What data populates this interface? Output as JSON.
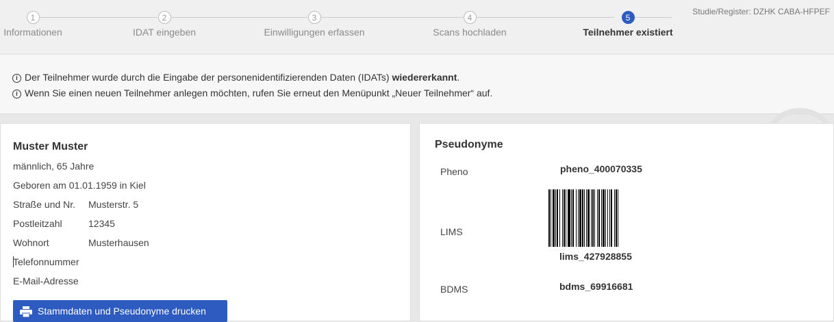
{
  "stepper": {
    "steps": [
      {
        "number": "1",
        "label": "Informationen"
      },
      {
        "number": "2",
        "label": "IDAT eingeben"
      },
      {
        "number": "3",
        "label": "Einwilligungen erfassen"
      },
      {
        "number": "4",
        "label": "Scans hochladen"
      },
      {
        "number": "5",
        "label": "Teilnehmer existiert"
      }
    ],
    "active_step": 5
  },
  "study_register": "Studie/Register: DZHK CABA-HFPEF",
  "info": {
    "line1_prefix": "Der Teilnehmer wurde durch die Eingabe der personenidentifizierenden Daten (IDATs) ",
    "line1_bold": "wiedererkannt",
    "line1_suffix": ".",
    "line2": "Wenn Sie einen neuen Teilnehmer anlegen möchten, rufen Sie erneut den Menüpunkt „Neuer Teilnehmer“ auf."
  },
  "participant": {
    "name": "Muster Muster",
    "gender_age": "männlich, 65 Jahre",
    "birth": "Geboren am 01.01.1959 in Kiel",
    "fields": [
      {
        "label": "Straße und Nr.",
        "value": "Musterstr. 5"
      },
      {
        "label": "Postleitzahl",
        "value": "12345"
      },
      {
        "label": "Wohnort",
        "value": "Musterhausen"
      },
      {
        "label": "Telefonnummer",
        "value": ""
      },
      {
        "label": "E-Mail-Adresse",
        "value": ""
      }
    ],
    "print_button": "Stammdaten und Pseudonyme drucken"
  },
  "pseudonyms": {
    "title": "Pseudonyme",
    "items": [
      {
        "label": "Pheno",
        "value": "pheno_400070335"
      },
      {
        "label": "LIMS",
        "value": "lims_427928855"
      },
      {
        "label": "BDMS",
        "value": "bdms_69916681"
      }
    ]
  },
  "icons": {
    "info": "info-circle-icon",
    "help": "question-circle-icon",
    "print": "printer-icon",
    "barcode": "barcode-icon"
  },
  "colors": {
    "primary": "#2d5bbf",
    "background": "#e8e8e8",
    "panel": "#ffffff"
  }
}
